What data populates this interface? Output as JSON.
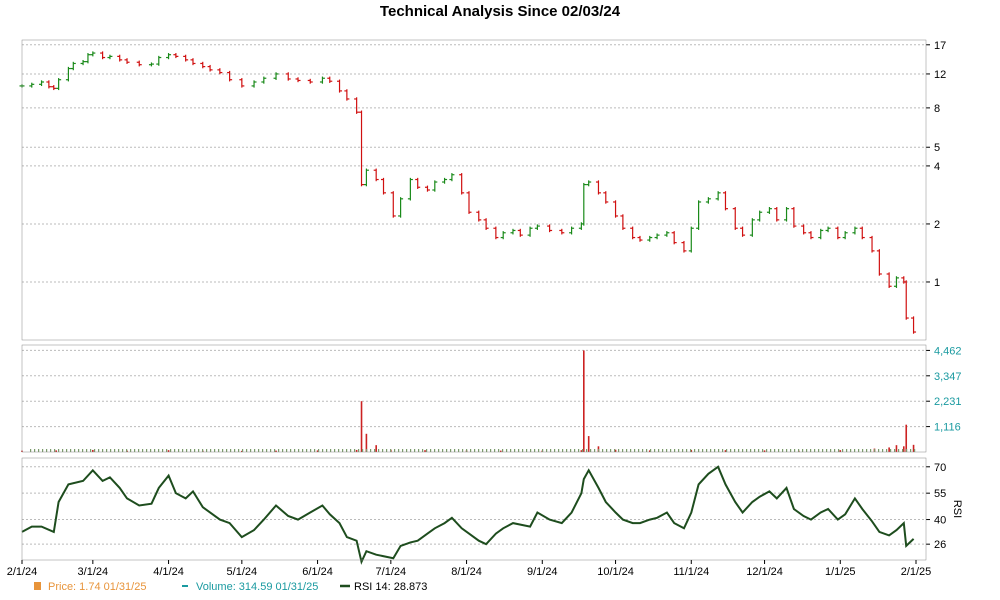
{
  "chart_data": {
    "type": "line",
    "title": "Technical Analysis Since 02/03/24",
    "x_ticks": [
      "2/1/24",
      "3/1/24",
      "4/1/24",
      "5/1/24",
      "6/1/24",
      "7/1/24",
      "8/1/24",
      "9/1/24",
      "10/1/24",
      "11/1/24",
      "12/1/24",
      "1/1/25",
      "2/1/25"
    ],
    "price_axis": {
      "scale": "log",
      "ticks": [
        "17",
        "12",
        "8",
        "5",
        "4",
        "2",
        "1"
      ]
    },
    "volume_axis": {
      "ticks": [
        "4,462",
        "3,347",
        "2,231",
        "1,116"
      ]
    },
    "rsi_axis": {
      "ticks": [
        "70",
        "55",
        "40",
        "26"
      ],
      "label": "RSI"
    },
    "price_series": [
      [
        "2/1/24",
        10.4
      ],
      [
        "2/5/24",
        10.6
      ],
      [
        "2/9/24",
        10.9
      ],
      [
        "2/12/24",
        10.3
      ],
      [
        "2/14/24",
        10.1
      ],
      [
        "2/16/24",
        11.2
      ],
      [
        "2/20/24",
        12.8
      ],
      [
        "2/22/24",
        13.6
      ],
      [
        "2/26/24",
        13.9
      ],
      [
        "2/28/24",
        15.1
      ],
      [
        "3/1/24",
        15.4
      ],
      [
        "3/5/24",
        14.6
      ],
      [
        "3/8/24",
        14.8
      ],
      [
        "3/12/24",
        14.2
      ],
      [
        "3/15/24",
        13.8
      ],
      [
        "3/20/24",
        13.4
      ],
      [
        "3/25/24",
        13.5
      ],
      [
        "3/28/24",
        14.6
      ],
      [
        "4/1/24",
        15.1
      ],
      [
        "4/4/24",
        14.8
      ],
      [
        "4/8/24",
        14.2
      ],
      [
        "4/11/24",
        13.6
      ],
      [
        "4/15/24",
        13.1
      ],
      [
        "4/18/24",
        12.6
      ],
      [
        "4/22/24",
        12.2
      ],
      [
        "4/26/24",
        11.2
      ],
      [
        "5/1/24",
        10.4
      ],
      [
        "5/6/24",
        10.9
      ],
      [
        "5/10/24",
        11.4
      ],
      [
        "5/15/24",
        12.0
      ],
      [
        "5/20/24",
        11.3
      ],
      [
        "5/24/24",
        11.1
      ],
      [
        "5/29/24",
        10.9
      ],
      [
        "6/3/24",
        11.4
      ],
      [
        "6/6/24",
        11.0
      ],
      [
        "6/10/24",
        9.8
      ],
      [
        "6/13/24",
        8.9
      ],
      [
        "6/17/24",
        7.6
      ],
      [
        "6/19/24",
        3.2
      ],
      [
        "6/21/24",
        3.8
      ],
      [
        "6/25/24",
        3.4
      ],
      [
        "6/28/24",
        2.9
      ],
      [
        "7/2/24",
        2.2
      ],
      [
        "7/5/24",
        2.7
      ],
      [
        "7/9/24",
        3.4
      ],
      [
        "7/12/24",
        3.1
      ],
      [
        "7/16/24",
        3.0
      ],
      [
        "7/19/24",
        3.3
      ],
      [
        "7/23/24",
        3.4
      ],
      [
        "7/26/24",
        3.6
      ],
      [
        "7/30/24",
        2.9
      ],
      [
        "8/2/24",
        2.3
      ],
      [
        "8/6/24",
        2.1
      ],
      [
        "8/9/24",
        1.9
      ],
      [
        "8/13/24",
        1.7
      ],
      [
        "8/16/24",
        1.8
      ],
      [
        "8/20/24",
        1.85
      ],
      [
        "8/23/24",
        1.75
      ],
      [
        "8/27/24",
        1.9
      ],
      [
        "8/30/24",
        1.95
      ],
      [
        "9/4/24",
        1.85
      ],
      [
        "9/9/24",
        1.8
      ],
      [
        "9/13/24",
        1.9
      ],
      [
        "9/17/24",
        2.0
      ],
      [
        "9/18/24",
        3.2
      ],
      [
        "9/20/24",
        3.3
      ],
      [
        "9/24/24",
        2.9
      ],
      [
        "9/27/24",
        2.6
      ],
      [
        "10/1/24",
        2.2
      ],
      [
        "10/4/24",
        1.9
      ],
      [
        "10/8/24",
        1.7
      ],
      [
        "10/11/24",
        1.65
      ],
      [
        "10/15/24",
        1.7
      ],
      [
        "10/18/24",
        1.75
      ],
      [
        "10/22/24",
        1.8
      ],
      [
        "10/25/24",
        1.6
      ],
      [
        "10/29/24",
        1.45
      ],
      [
        "11/1/24",
        1.9
      ],
      [
        "11/4/24",
        2.6
      ],
      [
        "11/8/24",
        2.7
      ],
      [
        "11/12/24",
        2.9
      ],
      [
        "11/15/24",
        2.4
      ],
      [
        "11/19/24",
        1.9
      ],
      [
        "11/22/24",
        1.75
      ],
      [
        "11/26/24",
        2.1
      ],
      [
        "11/29/24",
        2.3
      ],
      [
        "12/3/24",
        2.4
      ],
      [
        "12/6/24",
        2.1
      ],
      [
        "12/10/24",
        2.4
      ],
      [
        "12/13/24",
        1.95
      ],
      [
        "12/17/24",
        1.8
      ],
      [
        "12/20/24",
        1.7
      ],
      [
        "12/24/24",
        1.85
      ],
      [
        "12/27/24",
        1.9
      ],
      [
        "12/31/24",
        1.7
      ],
      [
        "1/3/25",
        1.8
      ],
      [
        "1/7/25",
        1.9
      ],
      [
        "1/10/25",
        1.7
      ],
      [
        "1/14/25",
        1.45
      ],
      [
        "1/17/25",
        1.1
      ],
      [
        "1/21/25",
        0.95
      ],
      [
        "1/24/25",
        1.05
      ],
      [
        "1/27/25",
        1.0
      ],
      [
        "1/28/25",
        0.65
      ],
      [
        "1/31/25",
        0.55
      ]
    ],
    "volume_series": [
      [
        "2/1/24",
        60
      ],
      [
        "2/15/24",
        70
      ],
      [
        "3/1/24",
        90
      ],
      [
        "3/15/24",
        60
      ],
      [
        "4/1/24",
        80
      ],
      [
        "4/15/24",
        60
      ],
      [
        "5/1/24",
        50
      ],
      [
        "5/15/24",
        60
      ],
      [
        "6/1/24",
        70
      ],
      [
        "6/17/24",
        90
      ],
      [
        "6/19/24",
        2231
      ],
      [
        "6/21/24",
        800
      ],
      [
        "6/25/24",
        300
      ],
      [
        "7/1/24",
        100
      ],
      [
        "7/15/24",
        80
      ],
      [
        "8/1/24",
        70
      ],
      [
        "8/15/24",
        60
      ],
      [
        "9/1/24",
        60
      ],
      [
        "9/17/24",
        80
      ],
      [
        "9/18/24",
        4462
      ],
      [
        "9/20/24",
        700
      ],
      [
        "9/24/24",
        250
      ],
      [
        "10/1/24",
        100
      ],
      [
        "10/15/24",
        70
      ],
      [
        "11/1/24",
        90
      ],
      [
        "11/15/24",
        80
      ],
      [
        "12/1/24",
        70
      ],
      [
        "12/15/24",
        60
      ],
      [
        "1/1/25",
        80
      ],
      [
        "1/15/25",
        150
      ],
      [
        "1/21/25",
        200
      ],
      [
        "1/24/25",
        300
      ],
      [
        "1/27/25",
        250
      ],
      [
        "1/28/25",
        1200
      ],
      [
        "1/31/25",
        315
      ]
    ],
    "rsi_series": [
      [
        "2/1/24",
        33
      ],
      [
        "2/5/24",
        36
      ],
      [
        "2/9/24",
        36
      ],
      [
        "2/14/24",
        33
      ],
      [
        "2/16/24",
        50
      ],
      [
        "2/20/24",
        60
      ],
      [
        "2/26/24",
        62
      ],
      [
        "3/1/24",
        68
      ],
      [
        "3/5/24",
        62
      ],
      [
        "3/8/24",
        64
      ],
      [
        "3/12/24",
        58
      ],
      [
        "3/15/24",
        52
      ],
      [
        "3/20/24",
        48
      ],
      [
        "3/25/24",
        49
      ],
      [
        "3/28/24",
        58
      ],
      [
        "4/1/24",
        65
      ],
      [
        "4/4/24",
        55
      ],
      [
        "4/8/24",
        52
      ],
      [
        "4/11/24",
        56
      ],
      [
        "4/15/24",
        47
      ],
      [
        "4/22/24",
        40
      ],
      [
        "4/26/24",
        38
      ],
      [
        "5/1/24",
        30
      ],
      [
        "5/6/24",
        34
      ],
      [
        "5/10/24",
        40
      ],
      [
        "5/15/24",
        48
      ],
      [
        "5/20/24",
        42
      ],
      [
        "5/24/24",
        40
      ],
      [
        "5/29/24",
        44
      ],
      [
        "6/3/24",
        48
      ],
      [
        "6/6/24",
        43
      ],
      [
        "6/10/24",
        38
      ],
      [
        "6/13/24",
        30
      ],
      [
        "6/17/24",
        28
      ],
      [
        "6/19/24",
        16
      ],
      [
        "6/21/24",
        22
      ],
      [
        "6/25/24",
        20
      ],
      [
        "7/2/24",
        18
      ],
      [
        "7/5/24",
        25
      ],
      [
        "7/9/24",
        27
      ],
      [
        "7/12/24",
        28
      ],
      [
        "7/16/24",
        32
      ],
      [
        "7/19/24",
        35
      ],
      [
        "7/23/24",
        38
      ],
      [
        "7/26/24",
        41
      ],
      [
        "7/30/24",
        35
      ],
      [
        "8/2/24",
        32
      ],
      [
        "8/6/24",
        28
      ],
      [
        "8/9/24",
        26
      ],
      [
        "8/13/24",
        32
      ],
      [
        "8/16/24",
        35
      ],
      [
        "8/20/24",
        38
      ],
      [
        "8/27/24",
        36
      ],
      [
        "8/30/24",
        44
      ],
      [
        "9/4/24",
        40
      ],
      [
        "9/9/24",
        38
      ],
      [
        "9/13/24",
        44
      ],
      [
        "9/17/24",
        55
      ],
      [
        "9/18/24",
        63
      ],
      [
        "9/20/24",
        68
      ],
      [
        "9/24/24",
        58
      ],
      [
        "9/27/24",
        50
      ],
      [
        "10/1/24",
        44
      ],
      [
        "10/4/24",
        40
      ],
      [
        "10/8/24",
        38
      ],
      [
        "10/11/24",
        38
      ],
      [
        "10/15/24",
        40
      ],
      [
        "10/18/24",
        41
      ],
      [
        "10/22/24",
        44
      ],
      [
        "10/25/24",
        38
      ],
      [
        "10/29/24",
        35
      ],
      [
        "11/1/24",
        44
      ],
      [
        "11/4/24",
        60
      ],
      [
        "11/8/24",
        66
      ],
      [
        "11/12/24",
        70
      ],
      [
        "11/15/24",
        60
      ],
      [
        "11/19/24",
        50
      ],
      [
        "11/22/24",
        44
      ],
      [
        "11/26/24",
        50
      ],
      [
        "11/29/24",
        53
      ],
      [
        "12/3/24",
        56
      ],
      [
        "12/6/24",
        52
      ],
      [
        "12/10/24",
        58
      ],
      [
        "12/13/24",
        46
      ],
      [
        "12/17/24",
        42
      ],
      [
        "12/20/24",
        40
      ],
      [
        "12/24/24",
        44
      ],
      [
        "12/27/24",
        46
      ],
      [
        "12/31/24",
        40
      ],
      [
        "1/3/25",
        43
      ],
      [
        "1/7/25",
        52
      ],
      [
        "1/10/25",
        46
      ],
      [
        "1/14/25",
        39
      ],
      [
        "1/17/25",
        33
      ],
      [
        "1/21/25",
        31
      ],
      [
        "1/24/25",
        34
      ],
      [
        "1/27/25",
        38
      ],
      [
        "1/28/25",
        25
      ],
      [
        "1/31/25",
        29
      ]
    ],
    "legend": [
      {
        "label": "Price: 1.74  01/31/25",
        "color": "#e8943a"
      },
      {
        "label": "Volume: 314.59  01/31/25",
        "color": "#1a9aa0"
      },
      {
        "label": "RSI 14: 28.873",
        "color": "#000000"
      }
    ],
    "colors": {
      "up": "#1a8a1a",
      "down": "#d01010",
      "volume": "#cc2222",
      "rsi": "#1e4d1e",
      "grid": "#bbbbbb"
    }
  }
}
